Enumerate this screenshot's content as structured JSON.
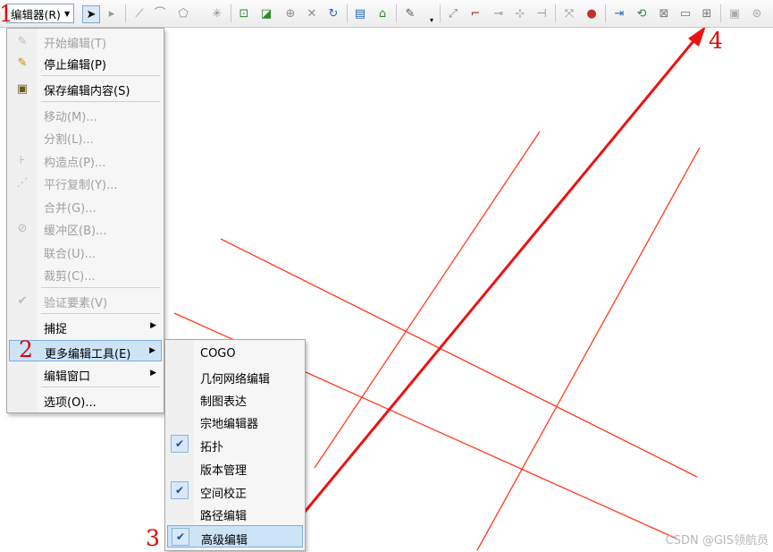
{
  "toolbar": {
    "editor_label": "编辑器(R)",
    "icons": [
      "edit-tool-icon",
      "edit-annotation-icon",
      "straight-segment-icon",
      "end-point-arc-icon",
      "trace-icon",
      "point-icon",
      "edit-vertices-icon",
      "reshape-feature-icon",
      "cut-polygons-icon",
      "split-tool-icon",
      "rotate-tool-icon",
      "attributes-icon",
      "sketch-properties-icon",
      "create-features-icon",
      "topology-edit-icon",
      "map-topology-icon",
      "new-displacement-link-icon",
      "new-identity-link-icon",
      "adjustment-preview-icon",
      "line-intersection-icon",
      "extend-tool-icon",
      "trim-tool-icon",
      "generalize-icon",
      "construct-geodetic-icon",
      "fillet-icon",
      "align-edge-icon",
      "rectangle-tool-icon",
      "copy-features-icon",
      "explode-icon",
      "more-tools-icon"
    ]
  },
  "main_menu": {
    "items": [
      {
        "label": "开始编辑(T)",
        "enabled": false,
        "icon": "pencil-icon"
      },
      {
        "label": "停止编辑(P)",
        "enabled": true,
        "icon": "pencil-stop-icon"
      },
      {
        "label": "保存编辑内容(S)",
        "enabled": true,
        "icon": "save-icon"
      },
      {
        "label": "移动(M)...",
        "enabled": false
      },
      {
        "label": "分割(L)...",
        "enabled": false
      },
      {
        "label": "构造点(P)...",
        "enabled": false,
        "icon": "construct-points-icon"
      },
      {
        "label": "平行复制(Y)...",
        "enabled": false,
        "icon": "copy-parallel-icon"
      },
      {
        "label": "合并(G)...",
        "enabled": false
      },
      {
        "label": "缓冲区(B)...",
        "enabled": false,
        "icon": "buffer-icon"
      },
      {
        "label": "联合(U)...",
        "enabled": false
      },
      {
        "label": "裁剪(C)...",
        "enabled": false
      },
      {
        "label": "验证要素(V)",
        "enabled": false,
        "icon": "validate-icon"
      },
      {
        "label": "捕捉",
        "enabled": true,
        "submenu": true
      },
      {
        "label": "更多编辑工具(E)",
        "enabled": true,
        "submenu": true,
        "highlighted": true
      },
      {
        "label": "编辑窗口",
        "enabled": true,
        "submenu": true
      },
      {
        "label": "选项(O)...",
        "enabled": true
      }
    ]
  },
  "sub_menu": {
    "items": [
      {
        "label": "COGO",
        "checked": false
      },
      {
        "label": "几何网络编辑",
        "checked": false
      },
      {
        "label": "制图表达",
        "checked": false
      },
      {
        "label": "宗地编辑器",
        "checked": false
      },
      {
        "label": "拓扑",
        "checked": true
      },
      {
        "label": "版本管理",
        "checked": false
      },
      {
        "label": "空间校正",
        "checked": true
      },
      {
        "label": "路径编辑",
        "checked": false
      },
      {
        "label": "高级编辑",
        "checked": true,
        "highlighted": true
      }
    ]
  },
  "annotations": {
    "n1": "1",
    "n2": "2",
    "n3": "3",
    "n4": "4"
  },
  "colors": {
    "annotation": "#e00000",
    "feature_line": "#ff3b1e",
    "menu_highlight": "#cde4f7"
  },
  "watermark": "CSDN @GIS领航员"
}
